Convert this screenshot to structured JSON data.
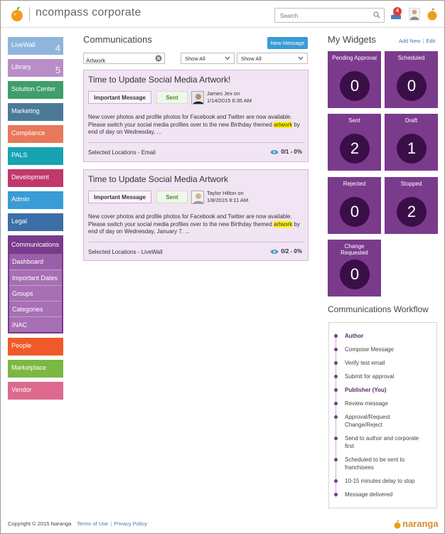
{
  "header": {
    "brand": "ncompass corporate",
    "search_placeholder": "Search",
    "notification_count": "4",
    "logo_icon": "orange-icon"
  },
  "sidebar": {
    "items": [
      {
        "label": "LiveWall",
        "count": "4",
        "color": "#8fb5dc"
      },
      {
        "label": "Library",
        "count": "5",
        "color": "#b98dc6"
      },
      {
        "label": "Solution Center",
        "color": "#3f9e6b"
      },
      {
        "label": "Marketing",
        "color": "#4b7a98"
      },
      {
        "label": "Compliance",
        "color": "#e9785a"
      },
      {
        "label": "PALS",
        "color": "#17a3b2"
      },
      {
        "label": "Development",
        "color": "#c0386c"
      },
      {
        "label": "Admin",
        "color": "#3a9bd6"
      },
      {
        "label": "Legal",
        "color": "#3c6fa7"
      }
    ],
    "communications": {
      "label": "Communications",
      "sub": [
        "Dashboard",
        "Important Dates",
        "Groups",
        "Categories",
        "iNAC"
      ]
    },
    "bottom_items": [
      {
        "label": "People",
        "color": "#ef5a28"
      },
      {
        "label": "Marketplace",
        "color": "#7bb842"
      },
      {
        "label": "Vendor",
        "color": "#dd6a8e"
      }
    ]
  },
  "main": {
    "title": "Communications",
    "new_message_label": "New Message",
    "filter_value": "Artwork",
    "select1": "Show All",
    "select2": "Show All",
    "cards": [
      {
        "title": "Time to Update Social Media Artwork!",
        "tag": "Important Message",
        "status": "Sent",
        "author_line1": "James Jex on",
        "author_line2": "1/14/2015 6:35 AM",
        "body_before": "New cover photos and profile photos for Facebook and Twitter are now available. Please switch your social media profiles over to the new Birthday themed ",
        "body_highlight": "artwork",
        "body_after": " by end of day on Wednesday, ...",
        "location": "Selected Locations - Email",
        "stat": "0/1 - 0%"
      },
      {
        "title": "Time to Update Social Media Artwork",
        "tag": "Important Message",
        "status": "Sent",
        "author_line1": "Taylor Hilton on",
        "author_line2": "1/8/2015 8:11 AM",
        "body_before": "New cover photos and profile photos for Facebook and Twitter are now available. Please switch your social media profiles over to the new Birthday themed ",
        "body_highlight": "artwork",
        "body_after": " by end of day on Wednesday, January 7. ...",
        "location": "Selected Locations - LiveWall",
        "stat": "0/2 - 0%"
      }
    ]
  },
  "widgets": {
    "title": "My Widgets",
    "add_new": "Add New",
    "edit": "Edit",
    "tiles": [
      {
        "label": "Pending Approval",
        "value": "0"
      },
      {
        "label": "Scheduled",
        "value": "0"
      },
      {
        "label": "Sent",
        "value": "2"
      },
      {
        "label": "Draft",
        "value": "1"
      },
      {
        "label": "Rejected",
        "value": "0"
      },
      {
        "label": "Stopped",
        "value": "2"
      },
      {
        "label": "Change Requested",
        "value": "0"
      }
    ]
  },
  "workflow": {
    "title": "Communications Workflow",
    "steps": [
      {
        "label": "Author",
        "bold": true
      },
      {
        "label": "Compose Message"
      },
      {
        "label": "Verify test email"
      },
      {
        "label": "Submit for approval"
      },
      {
        "label": "Publisher (You)",
        "bold": true
      },
      {
        "label": "Review message"
      },
      {
        "label": "Approval/Request Change/Reject"
      },
      {
        "label": "Send to author and corporate first"
      },
      {
        "label": "Scheduled to be sent to franchisees"
      },
      {
        "label": "10-15 minutes delay to stop"
      },
      {
        "label": "Message delivered"
      }
    ]
  },
  "footer": {
    "copyright": "Copyright © 2015 Naranga",
    "terms": "Terms of Use",
    "privacy": "Privacy Policy",
    "logo_text": "naranga"
  }
}
